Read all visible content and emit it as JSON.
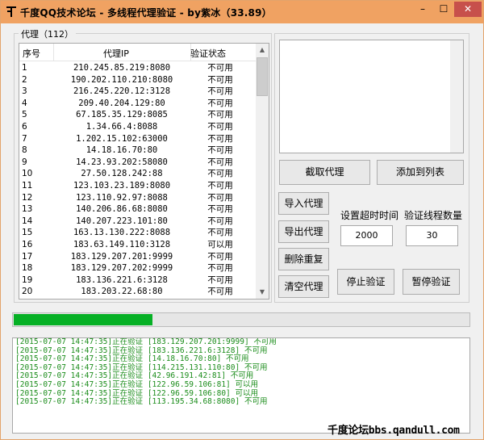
{
  "window": {
    "title": "千度QQ技术论坛 - 多线程代理验证 - by紫冰（33.89）",
    "controls": {
      "minimize": "–",
      "maximize": "☐",
      "close": "✕"
    }
  },
  "proxy_group": {
    "legend": "代理（112）",
    "columns": [
      "序号",
      "代理IP",
      "验证状态"
    ],
    "rows": [
      [
        "1",
        "210.245.85.219:8080",
        "不可用"
      ],
      [
        "2",
        "190.202.110.210:8080",
        "不可用"
      ],
      [
        "3",
        "216.245.220.12:3128",
        "不可用"
      ],
      [
        "4",
        "209.40.204.129:80",
        "不可用"
      ],
      [
        "5",
        "67.185.35.129:8085",
        "不可用"
      ],
      [
        "6",
        "1.34.66.4:8088",
        "不可用"
      ],
      [
        "7",
        "1.202.15.102:63000",
        "不可用"
      ],
      [
        "8",
        "14.18.16.70:80",
        "不可用"
      ],
      [
        "9",
        "14.23.93.202:58080",
        "不可用"
      ],
      [
        "10",
        "27.50.128.242:88",
        "不可用"
      ],
      [
        "11",
        "123.103.23.189:8080",
        "不可用"
      ],
      [
        "12",
        "123.110.92.97:8088",
        "不可用"
      ],
      [
        "13",
        "140.206.86.68:8080",
        "不可用"
      ],
      [
        "14",
        "140.207.223.101:80",
        "不可用"
      ],
      [
        "15",
        "163.13.130.222:8088",
        "不可用"
      ],
      [
        "16",
        "183.63.149.110:3128",
        "可以用"
      ],
      [
        "17",
        "183.129.207.201:9999",
        "不可用"
      ],
      [
        "18",
        "183.129.207.202:9999",
        "不可用"
      ],
      [
        "19",
        "183.136.221.6:3128",
        "不可用"
      ],
      [
        "20",
        "183.203.22.68:80",
        "不可用"
      ]
    ]
  },
  "buttons": {
    "extract": "截取代理",
    "add_to_list": "添加到列表",
    "import": "导入代理",
    "export": "导出代理",
    "dedupe": "删除重复",
    "clear": "清空代理",
    "stop": "停止验证",
    "pause": "暂停验证"
  },
  "settings": {
    "timeout_label": "设置超时时间",
    "timeout_value": "2000",
    "threads_label": "验证线程数量",
    "threads_value": "30"
  },
  "progress": {
    "fraction": 0.305
  },
  "log": [
    "[2015-07-07 14:47:35]正在验证 [183.129.207.201:9999] 不可用",
    "[2015-07-07 14:47:35]正在验证 [183.136.221.6:3128] 不可用",
    "[2015-07-07 14:47:35]正在验证 [14.18.16.70:80] 不可用",
    "[2015-07-07 14:47:35]正在验证 [114.215.131.110:80] 不可用",
    "[2015-07-07 14:47:35]正在验证 [42.96.191.42:81] 不可用",
    "[2015-07-07 14:47:35]正在验证 [122.96.59.106:81] 可以用",
    "[2015-07-07 14:47:35]正在验证 [122.96.59.106:80] 可以用",
    "[2015-07-07 14:47:35]正在验证 [113.195.34.68:8080] 不可用"
  ],
  "watermark": "千度论坛bbs.qandull.com",
  "colors": {
    "titlebar": "#f0a262",
    "progress": "#06b025",
    "log_text": "#1a8c1a",
    "close": "#c7504b"
  }
}
